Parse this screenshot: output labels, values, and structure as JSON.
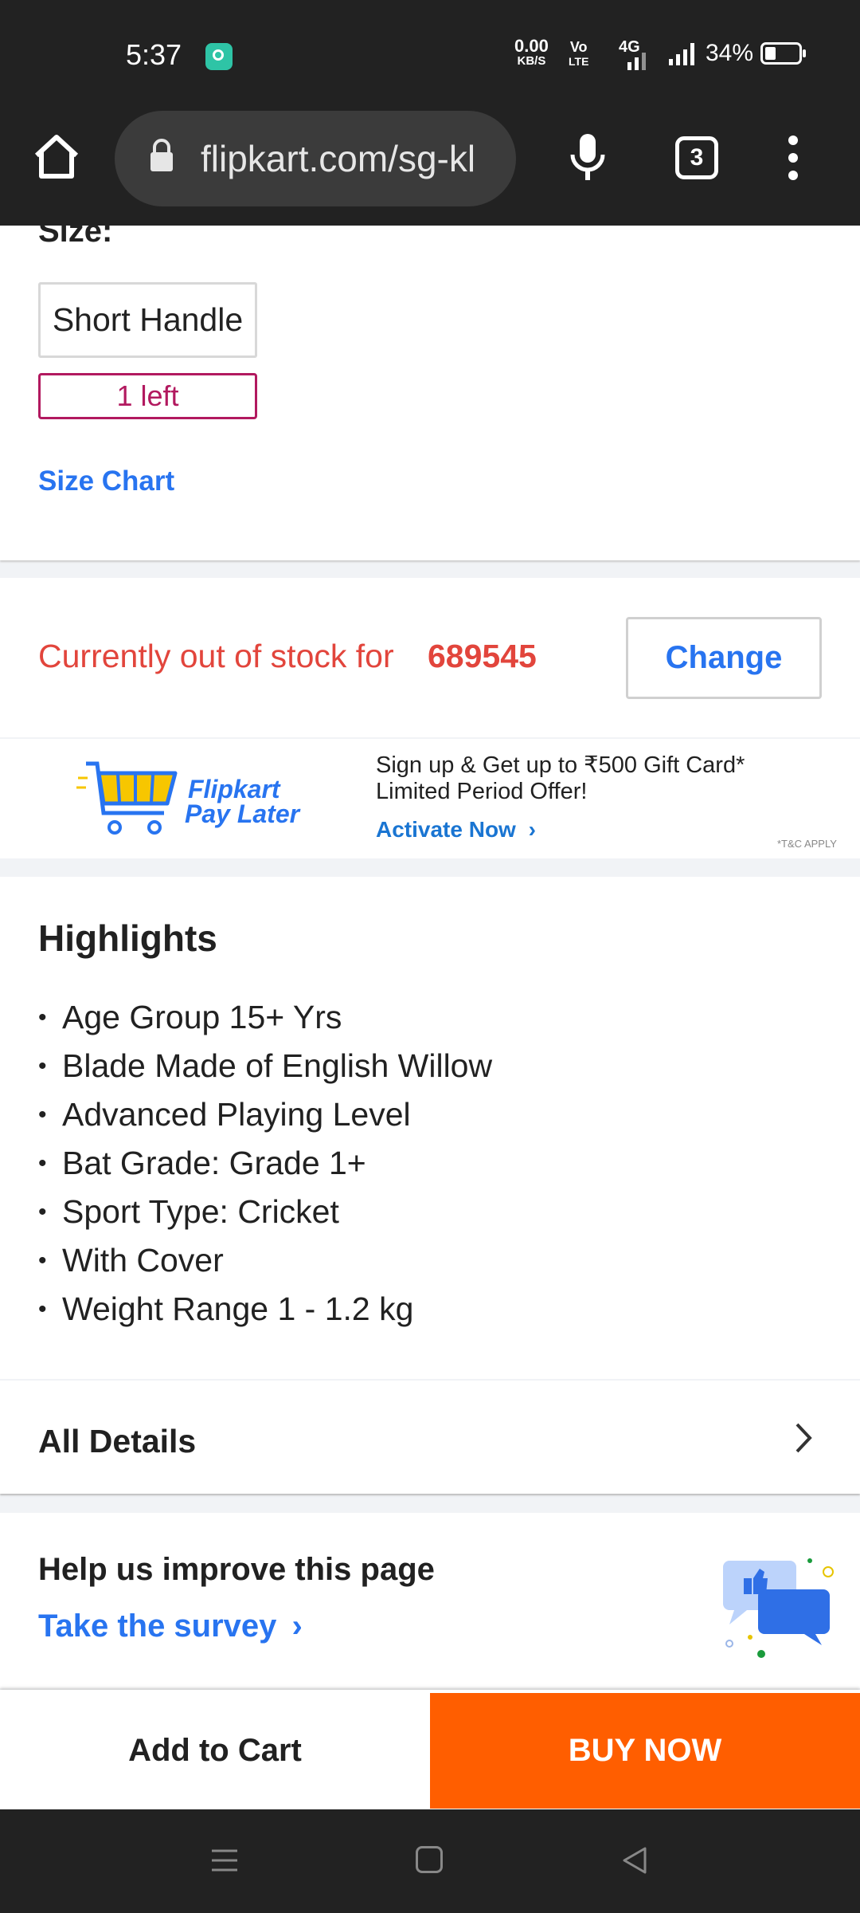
{
  "status_bar": {
    "time": "5:37",
    "net_speed_value": "0.00",
    "net_speed_unit": "KB/S",
    "volte_top": "Vo",
    "volte_bottom": "LTE",
    "network": "4G",
    "battery_pct": "34%"
  },
  "browser": {
    "url": "flipkart.com/sg-kl",
    "tab_count": "3"
  },
  "size_section": {
    "heading_partial": "Size:",
    "option_label": "Short Handle",
    "stock_badge": "1 left",
    "size_chart_link": "Size Chart"
  },
  "stock": {
    "message": "Currently out of stock for",
    "pincode": "689545",
    "change_button": "Change"
  },
  "pay_later": {
    "brand_line1": "Flipkart",
    "brand_line2": "Pay Later",
    "offer_line1": "Sign up & Get up to ₹500 Gift Card*",
    "offer_line2": "Limited Period Offer!",
    "cta": "Activate Now",
    "tc": "*T&C APPLY"
  },
  "highlights": {
    "title": "Highlights",
    "items": [
      "Age Group 15+ Yrs",
      "Blade Made of English Willow",
      "Advanced Playing Level",
      "Bat Grade: Grade 1+",
      "Sport Type: Cricket",
      "With Cover",
      "Weight Range 1 - 1.2 kg"
    ]
  },
  "details": {
    "label": "All Details"
  },
  "survey": {
    "title": "Help us improve this page",
    "link": "Take the survey"
  },
  "actions": {
    "add_to_cart": "Add to Cart",
    "buy_now": "BUY NOW"
  },
  "colors": {
    "flipkart_blue": "#2874f0",
    "buy_orange": "#ff5e00",
    "stock_red": "#e2453c",
    "badge_maroon": "#b2195f"
  },
  "icons": [
    "home-icon",
    "lock-icon",
    "mic-icon",
    "tabs-icon",
    "more-icon",
    "cart-icon",
    "chevron-right-icon",
    "survey-chat-icon"
  ]
}
